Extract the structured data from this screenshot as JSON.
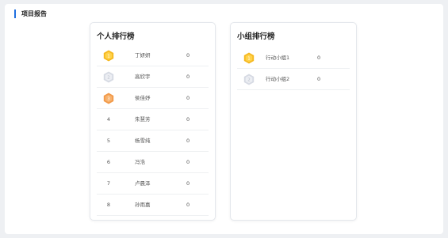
{
  "header": {
    "title": "项目报告"
  },
  "individual": {
    "title": "个人排行榜",
    "rows": [
      {
        "rank": "1",
        "medal": "gold",
        "name": "丁妍妍",
        "score": "0"
      },
      {
        "rank": "2",
        "medal": "silver",
        "name": "高欣宇",
        "score": "0"
      },
      {
        "rank": "3",
        "medal": "bronze",
        "name": "侯佳妤",
        "score": "0"
      },
      {
        "rank": "4",
        "name": "朱慧芳",
        "score": "0"
      },
      {
        "rank": "5",
        "name": "杨雪纯",
        "score": "0"
      },
      {
        "rank": "6",
        "name": "冯浩",
        "score": "0"
      },
      {
        "rank": "7",
        "name": "卢晨泽",
        "score": "0"
      },
      {
        "rank": "8",
        "name": "孙雨嘉",
        "score": "0"
      }
    ]
  },
  "team": {
    "title": "小组排行榜",
    "rows": [
      {
        "rank": "1",
        "medal": "gold",
        "name": "行动小组1",
        "score": "0"
      },
      {
        "rank": "2",
        "medal": "silver",
        "name": "行动小组2",
        "score": "0"
      }
    ]
  },
  "colors": {
    "accent": "#1f6fe0",
    "gold": "#f5b820",
    "silver": "#d6dae3",
    "bronze": "#f29a4a"
  }
}
